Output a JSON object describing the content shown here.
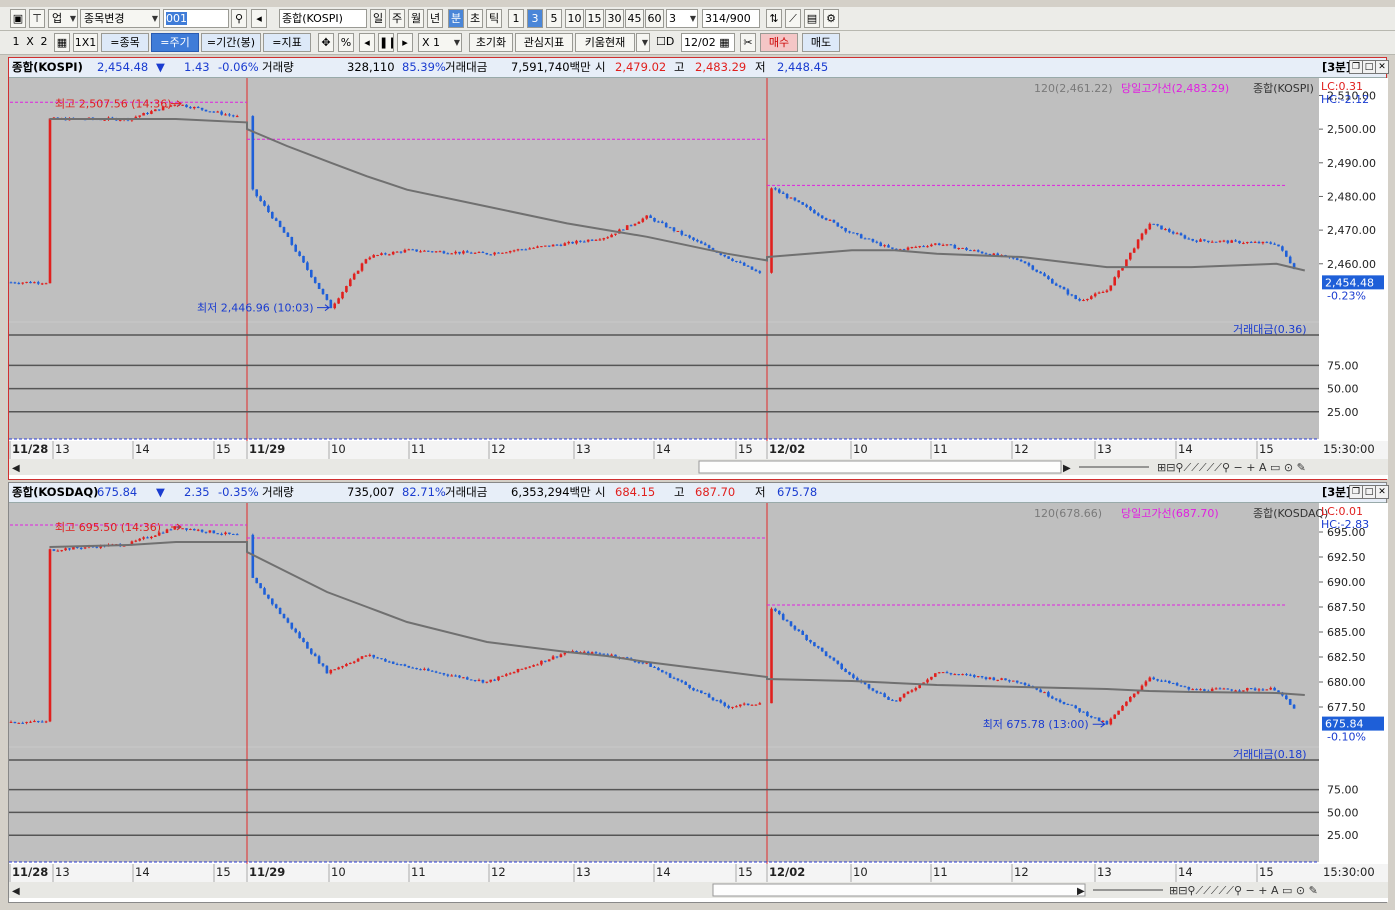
{
  "toolbar1": {
    "items": [
      "업",
      "종목변경",
      "001",
      "종합(KOSPI)",
      "일",
      "주",
      "월",
      "년",
      "분",
      "초",
      "틱",
      "1",
      "3",
      "5",
      "10",
      "15",
      "30",
      "45",
      "60",
      "3",
      "314",
      "/900"
    ]
  },
  "toolbar2": {
    "items": [
      "1",
      "X",
      "2",
      "1X1",
      "=종목",
      "=주기",
      "=기간(봉)",
      "=지표",
      "%",
      "X 1",
      "초기화",
      "관심지표",
      "키움현재",
      "D",
      "12/02",
      "매수",
      "매도"
    ]
  },
  "panels": [
    {
      "hdr": {
        "name": "종합(KOSPI)",
        "price": "2,454.48",
        "arrow": "▼",
        "chg": "1.43",
        "pct": "-0.06%",
        "vol_label": "거래량",
        "vol": "328,110",
        "vol_pct": "85.39%",
        "amt_label": "거래대금",
        "amt": "7,591,740백만",
        "o_label": "시",
        "o": "2,479.02",
        "h_label": "고",
        "h": "2,483.29",
        "l_label": "저",
        "l": "2,448.45",
        "period": "[3분]"
      },
      "legend": {
        "ma": "120(2,461.22)",
        "hl": "당일고가선(2,483.29)",
        "name": "종합(KOSPI)"
      },
      "lc": "LC:0.31",
      "hc": "HC:-2.12",
      "ann_high": "최고 2,507.56 (14:36)",
      "ann_low": "최저 2,446.96 (10:03)",
      "cur_price": "2,454.48",
      "cur_pct": "-0.23%",
      "yticks": [
        "2,510.00",
        "2,500.00",
        "2,490.00",
        "2,480.00",
        "2,470.00",
        "2,460.00"
      ],
      "sub_label": "거래대금(0.36)",
      "sub_ticks": [
        "75.00",
        "50.00",
        "25.00"
      ],
      "xlabels": [
        "11/28",
        "13",
        "14",
        "15",
        "11/29",
        "10",
        "11",
        "12",
        "13",
        "14",
        "15",
        "12/02",
        "10",
        "11",
        "12",
        "13",
        "14",
        "15"
      ],
      "time": "15:30:00"
    },
    {
      "hdr": {
        "name": "종합(KOSDAQ)",
        "price": "675.84",
        "arrow": "▼",
        "chg": "2.35",
        "pct": "-0.35%",
        "vol_label": "거래량",
        "vol": "735,007",
        "vol_pct": "82.71%",
        "amt_label": "거래대금",
        "amt": "6,353,294백만",
        "o_label": "시",
        "o": "684.15",
        "h_label": "고",
        "h": "687.70",
        "l_label": "저",
        "l": "675.78",
        "period": "[3분]"
      },
      "legend": {
        "ma": "120(678.66)",
        "hl": "당일고가선(687.70)",
        "name": "종합(KOSDAQ)"
      },
      "lc": "LC:0.01",
      "hc": "HC:-2.83",
      "ann_high": "최고 695.50 (14:36)",
      "ann_low": "최저 675.78 (13:00)",
      "cur_price": "675.84",
      "cur_pct": "-0.10%",
      "yticks": [
        "695.00",
        "692.50",
        "690.00",
        "687.50",
        "685.00",
        "682.50",
        "680.00",
        "677.50"
      ],
      "sub_label": "거래대금(0.18)",
      "sub_ticks": [
        "75.00",
        "50.00",
        "25.00"
      ],
      "xlabels": [
        "11/28",
        "13",
        "14",
        "15",
        "11/29",
        "10",
        "11",
        "12",
        "13",
        "14",
        "15",
        "12/02",
        "10",
        "11",
        "12",
        "13",
        "14",
        "15"
      ],
      "time": "15:30:00"
    }
  ],
  "chart_data": [
    {
      "type": "line",
      "title": "종합(KOSPI) 3분",
      "ylim": [
        2443,
        2514
      ],
      "x": [
        "11/28 13:00",
        "11/28 14:00",
        "11/28 14:36",
        "11/28 15:30",
        "11/29 09:00",
        "11/29 09:30",
        "11/29 10:03",
        "11/29 10:30",
        "11/29 11:00",
        "11/29 12:00",
        "11/29 13:00",
        "11/29 13:30",
        "11/29 14:00",
        "11/29 15:00",
        "11/29 15:30",
        "12/02 09:00",
        "12/02 10:00",
        "12/02 10:30",
        "12/02 11:00",
        "12/02 12:00",
        "12/02 12:40",
        "12/02 13:00",
        "12/02 13:30",
        "12/02 14:00",
        "12/02 15:00",
        "12/02 15:20"
      ],
      "close": [
        2503,
        2503,
        2507.56,
        2503,
        2484,
        2468,
        2446.96,
        2462,
        2464,
        2463,
        2466,
        2468,
        2474,
        2462,
        2456,
        2483.29,
        2469,
        2464,
        2466,
        2461,
        2449,
        2452,
        2472,
        2467,
        2466,
        2454.48
      ],
      "ma120": [
        2503,
        2503,
        2503,
        2502,
        2500,
        2495,
        2490,
        2486,
        2482,
        2477,
        2472,
        2470,
        2468,
        2463,
        2461,
        2462,
        2464,
        2464,
        2463,
        2462,
        2460,
        2459,
        2459,
        2459,
        2460,
        2458
      ],
      "day_high_line": [
        {
          "day": "11/28",
          "value": 2508
        },
        {
          "day": "11/29",
          "value": 2497
        },
        {
          "day": "12/02",
          "value": 2483.29
        }
      ]
    },
    {
      "type": "line",
      "title": "종합(KOSDAQ) 3분",
      "ylim": [
        673.6,
        697.5
      ],
      "x": [
        "11/28 13:00",
        "11/28 14:00",
        "11/28 14:36",
        "11/28 15:30",
        "11/29 09:00",
        "11/29 09:30",
        "11/29 10:00",
        "11/29 10:30",
        "11/29 11:00",
        "11/29 12:00",
        "11/29 13:00",
        "11/29 13:30",
        "11/29 14:00",
        "11/29 15:00",
        "11/29 15:30",
        "12/02 09:00",
        "12/02 10:00",
        "12/02 10:30",
        "12/02 11:00",
        "12/02 12:00",
        "12/02 13:00",
        "12/02 13:30",
        "12/02 14:00",
        "12/02 15:00",
        "12/02 15:20"
      ],
      "close": [
        693.2,
        693.8,
        695.5,
        694.5,
        691,
        686,
        681,
        682.7,
        681.5,
        680,
        683,
        682.8,
        681.8,
        677.5,
        678,
        687.7,
        680.5,
        678,
        681,
        680,
        675.78,
        680.5,
        679.2,
        679.3,
        676
      ],
      "ma120": [
        693.5,
        693.7,
        694,
        694,
        693,
        691,
        689,
        687.5,
        686,
        684,
        683,
        682.6,
        682,
        681,
        680.5,
        680.3,
        680.1,
        679.9,
        679.7,
        679.5,
        679.3,
        679.1,
        679,
        678.9,
        678.7
      ],
      "day_high_line": [
        {
          "day": "11/28",
          "value": 695.7
        },
        {
          "day": "11/29",
          "value": 694.4
        },
        {
          "day": "12/02",
          "value": 687.7
        }
      ]
    }
  ]
}
